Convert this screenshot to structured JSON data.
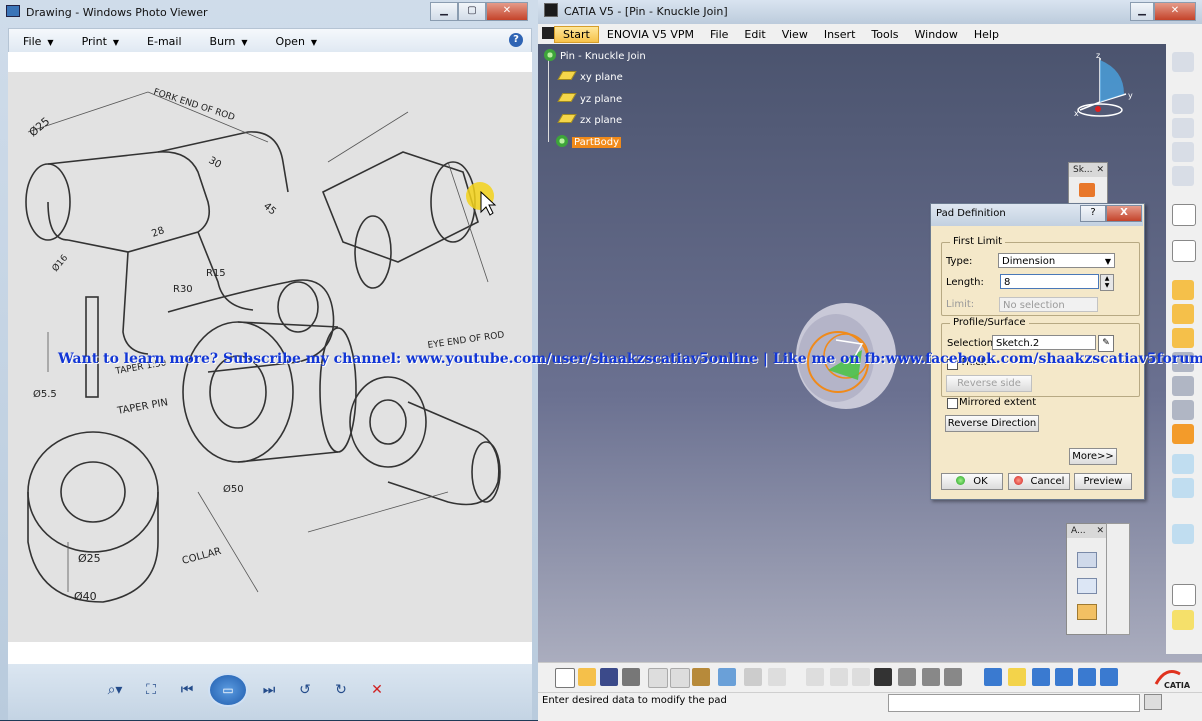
{
  "photo_viewer": {
    "title": "Drawing - Windows Photo Viewer",
    "menu": {
      "file": "File",
      "print": "Print",
      "email": "E-mail",
      "burn": "Burn",
      "open": "Open"
    },
    "drawing_labels": {
      "fork_end": "FORK END OF ROD",
      "eye_end": "EYE END OF ROD",
      "taper_pin": "TAPER PIN",
      "taper": "TAPER 1:50",
      "collar": "COLLAR",
      "dim_25": "Ø25",
      "dim_16": "Ø16",
      "dim_55": "Ø5.5",
      "dim_50": "Ø50",
      "dim_40": "Ø40",
      "dim_25b": "Ø25",
      "r15": "R15",
      "r30": "R30",
      "d28": "28",
      "d30": "30",
      "d45": "45"
    }
  },
  "overlay_text": "Want to learn more? Subscribe my channel: www.youtube.com/user/shaakzscatiav5online | Like me on fb:www.facebook.com/shaakzscatiav5forum",
  "catia": {
    "title": "CATIA V5 - [Pin - Knuckle Join]",
    "menu": [
      "Start",
      "ENOVIA V5 VPM",
      "File",
      "Edit",
      "View",
      "Insert",
      "Tools",
      "Window",
      "Help"
    ],
    "tree": {
      "root": "Pin - Knuckle Join",
      "xy": "xy plane",
      "yz": "yz plane",
      "zx": "zx plane",
      "partbody": "PartBody"
    },
    "float_sk": "Sk...",
    "float_a": "A...",
    "status": "Enter desired data to modify the pad",
    "compass": {
      "x": "x",
      "y": "y",
      "z": "z"
    }
  },
  "pad_dialog": {
    "title": "Pad Definition",
    "help": "?",
    "close": "X",
    "first_limit": "First Limit",
    "type_label": "Type:",
    "type_value": "Dimension",
    "length_label": "Length:",
    "length_value": "8",
    "limit_label": "Limit:",
    "limit_value": "No selection",
    "profile_surface": "Profile/Surface",
    "selection_label": "Selection:",
    "selection_value": "Sketch.2",
    "thick_label": "Thick",
    "reverse_side": "Reverse side",
    "mirrored_extent": "Mirrored extent",
    "reverse_direction": "Reverse Direction",
    "more": "More>>",
    "ok": "OK",
    "cancel": "Cancel",
    "preview": "Preview"
  }
}
